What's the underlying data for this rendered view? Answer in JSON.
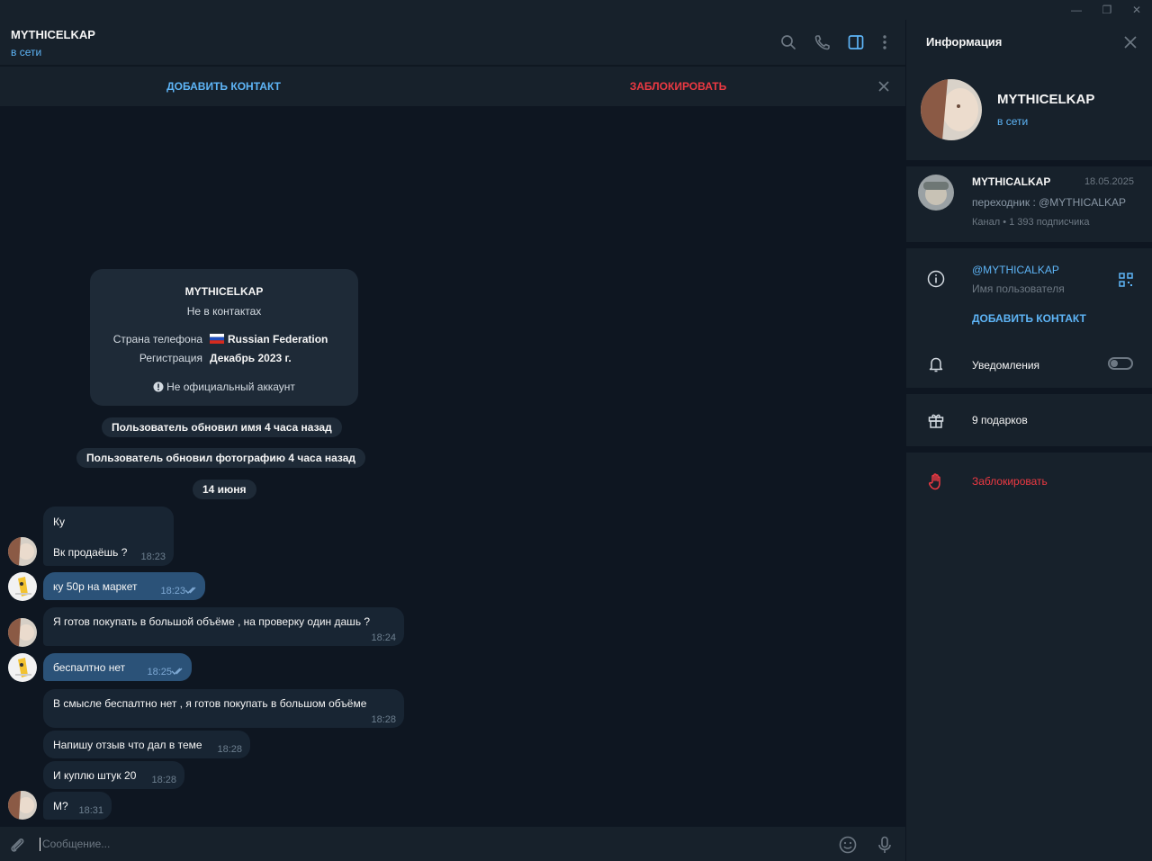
{
  "window": {
    "minimize": "—",
    "restore": "❐",
    "close": "✕"
  },
  "chat": {
    "title": "MYTHICELKAP",
    "status": "в сети",
    "add_contact": "ДОБАВИТЬ КОНТАКТ",
    "block": "ЗАБЛОКИРОВАТЬ"
  },
  "info_card": {
    "name": "MYTHICELKAP",
    "not_in_contacts": "Не в контактах",
    "phone_country_label": "Страна телефона",
    "phone_country_value": "Russian Federation",
    "registration_label": "Регистрация",
    "registration_value": "Декабрь 2023 г.",
    "unofficial": "Не официальный аккаунт"
  },
  "service": {
    "name_update": "Пользователь обновил имя 4 часа назад",
    "photo_update": "Пользователь обновил фотографию 4 часа назад",
    "date": "14 июня"
  },
  "messages": [
    {
      "dir": "in",
      "text": "Ку",
      "time": ""
    },
    {
      "dir": "in",
      "text": "Вк продаёшь ?",
      "time": "18:23"
    },
    {
      "dir": "out",
      "text": "ку 50р на маркет",
      "time": "18:23"
    },
    {
      "dir": "in",
      "text": "Я готов покупать в большой объёме , на проверку один дашь ?",
      "time": "18:24"
    },
    {
      "dir": "out",
      "text": "беспалтно нет",
      "time": "18:25"
    },
    {
      "dir": "in",
      "text": "В смысле беспалтно нет , я готов покупать в большом объёме",
      "time": "18:28"
    },
    {
      "dir": "in",
      "text": "Напишу отзыв что дал в теме",
      "time": "18:28"
    },
    {
      "dir": "in",
      "text": "И куплю штук 20",
      "time": "18:28"
    },
    {
      "dir": "in",
      "text": "М?",
      "time": "18:31"
    }
  ],
  "composer": {
    "placeholder": "Сообщение..."
  },
  "panel": {
    "title": "Информация",
    "name": "MYTHICELKAP",
    "status": "в сети",
    "channel": {
      "name": "MYTHICALKAP",
      "date": "18.05.2025",
      "desc": "переходник : @MYTHICALKAP",
      "subs": "Канал • 1 393 подписчика"
    },
    "username": "@MYTHICALKAP",
    "username_label": "Имя пользователя",
    "add_contact": "ДОБАВИТЬ КОНТАКТ",
    "notifications": "Уведомления",
    "notifications_on": false,
    "gifts": "9 подарков",
    "block": "Заблокировать"
  },
  "colors": {
    "accent": "#5eb5f7",
    "danger": "#ec3942",
    "outgoing": "#2b5278",
    "incoming": "#182533"
  }
}
